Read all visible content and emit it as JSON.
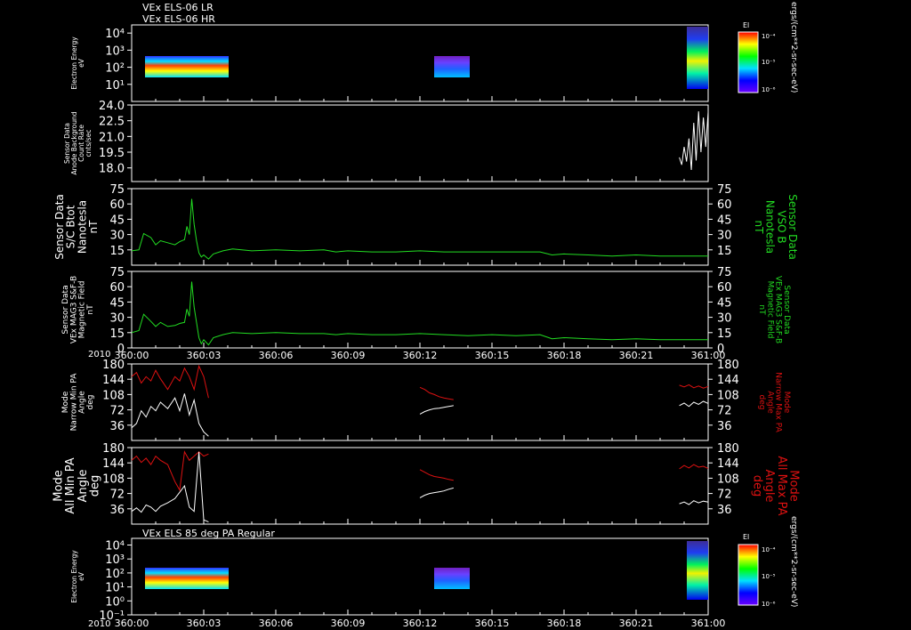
{
  "header": {
    "line1": "VEx ELS-06 LR",
    "line2": "VEx ELS-06 HR"
  },
  "bottom_title": "VEx ELS 85 deg PA Regular",
  "year_label": "2010",
  "x_ticks": [
    "360:00",
    "360:03",
    "360:06",
    "360:09",
    "360:12",
    "360:15",
    "360:18",
    "360:21",
    "361:00"
  ],
  "colors": {
    "green": "#22dd22",
    "red": "#dd1111",
    "white": "#ffffff",
    "frame": "#ffffff"
  },
  "colorbar": {
    "label": "El",
    "ticks": [
      "10⁻⁴",
      "10⁻⁵",
      "10⁻⁶"
    ],
    "units": "ergs/(cm**2-sr-sec-eV)"
  },
  "chart_data": [
    {
      "type": "heatmap",
      "panel": "ELS-06 energy spectrogram",
      "ylabel": [
        "Electron Energy",
        "eV"
      ],
      "y_ticks": [
        "10⁴",
        "10³",
        "10²",
        "10¹"
      ],
      "ylim": [
        1,
        30000
      ],
      "yscale": "log",
      "data_intervals": [
        [
          "360:00",
          "360:03"
        ],
        [
          "360:12",
          "360:13"
        ],
        [
          "360:22.8",
          "361:00"
        ]
      ]
    },
    {
      "type": "line",
      "panel": "Anode background",
      "ylabel": [
        "Sensor Data",
        "Anode Background",
        "Count Rate",
        "cnts/sec"
      ],
      "y_ticks": [
        "24.0",
        "22.5",
        "21.0",
        "19.5",
        "18.0"
      ],
      "ylim": [
        16.7,
        24.0
      ],
      "series": [
        {
          "color": "white",
          "x": [
            22.8,
            22.9,
            23.0,
            23.1,
            23.2,
            23.3,
            23.4,
            23.5,
            23.6,
            23.7,
            23.8,
            23.9,
            24.0
          ],
          "y": [
            19.0,
            18.3,
            20.0,
            18.6,
            20.8,
            17.8,
            22.3,
            18.7,
            23.4,
            19.5,
            22.8,
            20.0,
            23.3
          ]
        }
      ]
    },
    {
      "type": "line",
      "panel": "S/C Btot",
      "ylabel": [
        "Sensor Data",
        "S/C Btot",
        "Nanotesla",
        "nT"
      ],
      "right_label": [
        "Sensor Data",
        "VSO B",
        "Nanotesla",
        "nT"
      ],
      "y_ticks": [
        "75",
        "60",
        "45",
        "30",
        "15"
      ],
      "ylim": [
        0,
        75
      ],
      "series": [
        {
          "color": "green",
          "x": [
            0,
            0.3,
            0.5,
            0.8,
            1.0,
            1.2,
            1.5,
            1.8,
            2.0,
            2.2,
            2.3,
            2.4,
            2.5,
            2.6,
            2.7,
            2.8,
            2.9,
            3.0,
            3.2,
            3.4,
            3.8,
            4.2,
            5.0,
            6.0,
            7.0,
            8.0,
            8.5,
            9.0,
            10.0,
            11.0,
            12.0,
            13.0,
            14.0,
            15.0,
            16.0,
            17.0,
            17.5,
            18.0,
            19.0,
            20.0,
            21.0,
            22.0,
            23.0,
            24.0
          ],
          "y": [
            14,
            15,
            31,
            27,
            20,
            24,
            22,
            20,
            23,
            25,
            38,
            30,
            65,
            40,
            24,
            12,
            8,
            10,
            6,
            11,
            14,
            16,
            14,
            15,
            14,
            15,
            13,
            14,
            13,
            13,
            14,
            13,
            13,
            13,
            13,
            13,
            10,
            11,
            10,
            9,
            10,
            9,
            9,
            9
          ]
        }
      ]
    },
    {
      "type": "line",
      "panel": "MAG S&F-B Magnetic Field",
      "ylabel": [
        "Sensor Data",
        "VEx MAG3 S&F-B",
        "Magnetic Field",
        "nT"
      ],
      "right_label": [
        "Sensor Data",
        "VEx MAG3 S&F-B",
        "Magnetic Field",
        "nT"
      ],
      "y_ticks": [
        "75",
        "60",
        "45",
        "30",
        "15",
        "0"
      ],
      "ylim": [
        0,
        75
      ],
      "series": [
        {
          "color": "green",
          "x": [
            0,
            0.3,
            0.5,
            0.8,
            1.0,
            1.2,
            1.5,
            1.8,
            2.0,
            2.2,
            2.3,
            2.4,
            2.5,
            2.6,
            2.7,
            2.8,
            2.9,
            3.0,
            3.2,
            3.4,
            3.8,
            4.2,
            5.0,
            6.0,
            7.0,
            8.0,
            8.5,
            9.0,
            10.0,
            11.0,
            12.0,
            13.0,
            14.0,
            15.0,
            16.0,
            17.0,
            17.5,
            18.0,
            19.0,
            20.0,
            21.0,
            22.0,
            23.0,
            24.0
          ],
          "y": [
            15,
            17,
            33,
            26,
            21,
            25,
            21,
            22,
            24,
            25,
            38,
            31,
            65,
            40,
            25,
            10,
            4,
            8,
            3,
            10,
            13,
            15,
            14,
            15,
            14,
            14,
            13,
            14,
            13,
            13,
            14,
            13,
            12,
            13,
            12,
            13,
            9,
            10,
            9,
            8,
            9,
            8,
            8,
            8
          ]
        }
      ]
    },
    {
      "type": "line",
      "panel": "Narrow Min/Max PA",
      "ylabel": [
        "Mode",
        "Narrow Min PA",
        "Angle",
        "deg"
      ],
      "right_label": [
        "Mode",
        "Narrow Max PA",
        "Angle",
        "deg"
      ],
      "y_ticks": [
        "180",
        "144",
        "108",
        "72",
        "36"
      ],
      "ylim": [
        0,
        180
      ],
      "series": [
        {
          "color": "red",
          "x": [
            0,
            0.2,
            0.4,
            0.6,
            0.8,
            1.0,
            1.2,
            1.5,
            1.8,
            2.0,
            2.2,
            2.4,
            2.6,
            2.8,
            3.0,
            3.2
          ],
          "y": [
            150,
            160,
            135,
            150,
            140,
            165,
            145,
            120,
            150,
            140,
            170,
            150,
            120,
            175,
            150,
            100
          ]
        },
        {
          "color": "red",
          "x": [
            12.0,
            12.2,
            12.4,
            12.6,
            12.8,
            13.0,
            13.2,
            13.4
          ],
          "y": [
            125,
            120,
            112,
            108,
            103,
            100,
            98,
            96
          ]
        },
        {
          "color": "red",
          "x": [
            22.8,
            23.0,
            23.2,
            23.4,
            23.6,
            23.8,
            24.0
          ],
          "y": [
            130,
            126,
            131,
            124,
            128,
            123,
            127
          ]
        },
        {
          "color": "white",
          "x": [
            0,
            0.2,
            0.4,
            0.6,
            0.8,
            1.0,
            1.2,
            1.5,
            1.8,
            2.0,
            2.2,
            2.4,
            2.6,
            2.8,
            3.0,
            3.2
          ],
          "y": [
            30,
            40,
            70,
            55,
            80,
            70,
            90,
            75,
            100,
            70,
            110,
            60,
            95,
            40,
            20,
            10
          ]
        },
        {
          "color": "white",
          "x": [
            12.0,
            12.2,
            12.4,
            12.6,
            12.8,
            13.0,
            13.2,
            13.4
          ],
          "y": [
            62,
            68,
            72,
            75,
            76,
            78,
            80,
            82
          ]
        },
        {
          "color": "white",
          "x": [
            22.8,
            23.0,
            23.2,
            23.4,
            23.6,
            23.8,
            24.0
          ],
          "y": [
            82,
            88,
            80,
            90,
            85,
            92,
            87
          ]
        }
      ]
    },
    {
      "type": "line",
      "panel": "All Min/Max PA",
      "ylabel": [
        "Mode",
        "All Min PA",
        "Angle",
        "deg"
      ],
      "right_label": [
        "Mode",
        "All Max PA",
        "Angle",
        "deg"
      ],
      "y_ticks": [
        "180",
        "144",
        "108",
        "72",
        "36"
      ],
      "ylim": [
        0,
        180
      ],
      "series": [
        {
          "color": "red",
          "x": [
            0,
            0.2,
            0.4,
            0.6,
            0.8,
            1.0,
            1.2,
            1.5,
            1.8,
            2.0,
            2.2,
            2.4,
            2.6,
            2.8,
            3.0,
            3.2
          ],
          "y": [
            150,
            160,
            145,
            155,
            140,
            160,
            150,
            140,
            100,
            80,
            170,
            150,
            160,
            170,
            160,
            165
          ]
        },
        {
          "color": "red",
          "x": [
            12.0,
            12.2,
            12.4,
            12.6,
            12.8,
            13.0,
            13.2,
            13.4
          ],
          "y": [
            128,
            122,
            116,
            112,
            110,
            108,
            105,
            103
          ]
        },
        {
          "color": "red",
          "x": [
            22.8,
            23.0,
            23.2,
            23.4,
            23.6,
            23.8,
            24.0
          ],
          "y": [
            130,
            138,
            132,
            140,
            134,
            136,
            131
          ]
        },
        {
          "color": "white",
          "x": [
            0,
            0.2,
            0.4,
            0.6,
            0.8,
            1.0,
            1.2,
            1.5,
            1.8,
            2.0,
            2.2,
            2.4,
            2.6,
            2.8,
            3.0,
            3.2
          ],
          "y": [
            30,
            38,
            28,
            45,
            40,
            30,
            42,
            50,
            60,
            75,
            90,
            40,
            30,
            170,
            10,
            5
          ]
        },
        {
          "color": "white",
          "x": [
            12.0,
            12.2,
            12.4,
            12.6,
            12.8,
            13.0,
            13.2,
            13.4
          ],
          "y": [
            62,
            68,
            72,
            74,
            76,
            78,
            82,
            85
          ]
        },
        {
          "color": "white",
          "x": [
            22.8,
            23.0,
            23.2,
            23.4,
            23.6,
            23.8,
            24.0
          ],
          "y": [
            48,
            52,
            46,
            55,
            50,
            54,
            52
          ]
        }
      ]
    },
    {
      "type": "heatmap",
      "panel": "ELS 85 deg PA spectrogram",
      "ylabel": [
        "Electron Energy",
        "eV"
      ],
      "y_ticks": [
        "10⁴",
        "10³",
        "10²",
        "10¹",
        "10⁰",
        "10⁻¹"
      ],
      "ylim": [
        0.1,
        30000
      ],
      "yscale": "log",
      "data_intervals": [
        [
          "360:00",
          "360:03"
        ],
        [
          "360:12",
          "360:13"
        ],
        [
          "360:22.8",
          "361:00"
        ]
      ]
    }
  ]
}
